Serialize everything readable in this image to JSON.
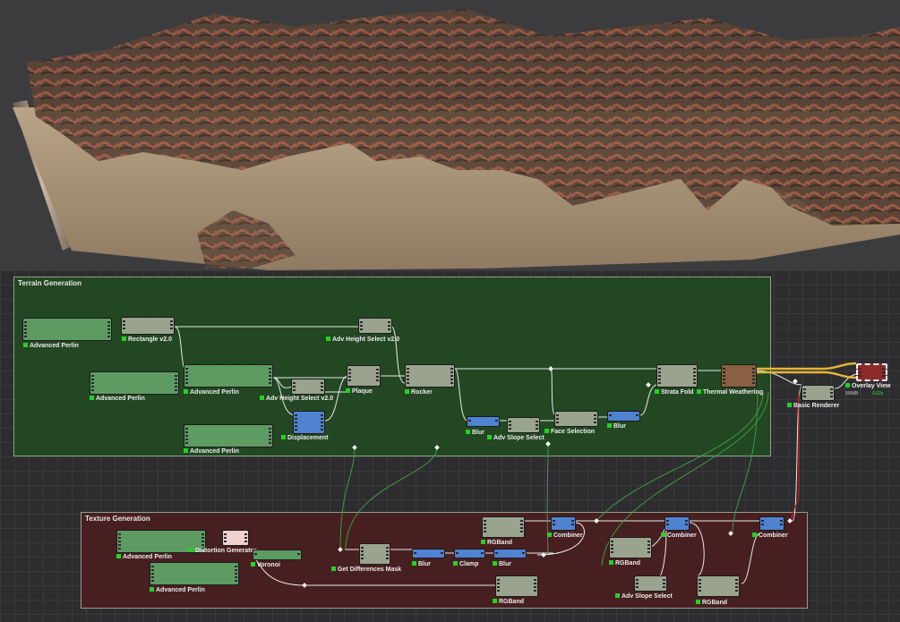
{
  "groups": {
    "terrain": {
      "title": "Terrain Generation"
    },
    "texture": {
      "title": "Texture Generation"
    }
  },
  "nodes": {
    "adv_perlin_1": "Advanced Perlin",
    "rectangle": "Rectangle v2.0",
    "adv_height_select_top": "Adv Height Select v2.0",
    "adv_perlin_2": "Advanced Perlin",
    "adv_perlin_3": "Advanced Perlin",
    "adv_height_select_mid": "Adv Height Select v2.0",
    "plaque": "Plaque",
    "displacement": "Displacement",
    "adv_perlin_4": "Advanced Perlin",
    "rocker": "Rocker",
    "blur_1": "Blur",
    "adv_slope_select_1": "Adv Slope Select",
    "face_selection": "Face Selection",
    "blur_2": "Blur",
    "strata_fold": "Strata Fold",
    "thermal_weathering": "Thermal Weathering",
    "basic_renderer": "Basic Renderer",
    "overlay_view": "Overlay View",
    "overlay_view_res": "8/8MB",
    "overlay_view_time": "0.02s",
    "adv_perlin_5": "Advanced Perlin",
    "distortion_generator": "Distortion Generator",
    "voronoi": "Voronoi",
    "adv_perlin_6": "Advanced Perlin",
    "get_differences_mask": "Get Differences Mask",
    "blur_3": "Blur",
    "clamp": "Clamp",
    "blur_4": "Blur",
    "rgband_1": "RGBand",
    "combiner_1": "Combiner",
    "rgband_2": "RGBand",
    "rgband_3": "RGBand",
    "combiner_2": "Combiner",
    "adv_slope_select_2": "Adv Slope Select",
    "rgband_4": "RGBand",
    "combiner_3": "Combiner"
  },
  "colors": {
    "perlin": "#5e9b63",
    "filter": "#9aa38e",
    "blur": "#4f82d0",
    "distortion": "#f1cfd2",
    "weathering": "#8a6042",
    "output": "#8b2b2b",
    "terrain_group": "#224a22",
    "texture_group": "#4a1e20",
    "status_led": "#21d421"
  }
}
